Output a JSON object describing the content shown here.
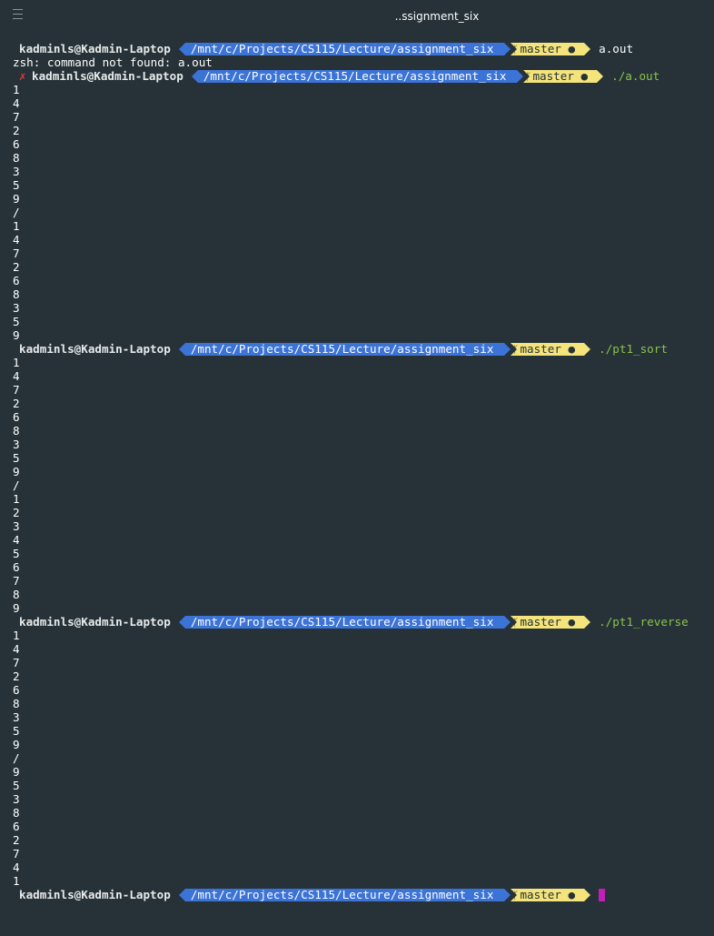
{
  "window": {
    "title": "..ssignment_six",
    "menu_icon": "hamburger-icon"
  },
  "prompt": {
    "context": "kadminls@Kadmin-Laptop",
    "dir": "/mnt/c/Projects/CS115/Lecture/assignment_six",
    "branch": "master ●",
    "error_mark": "✗"
  },
  "commands": {
    "c1": "a.out",
    "c2": "./a.out",
    "c3": "./pt1_sort",
    "c4": "./pt1_reverse"
  },
  "error_message": "zsh: command not found: a.out",
  "outputs": {
    "run_a_out": [
      "1",
      "4",
      "7",
      "2",
      "6",
      "8",
      "3",
      "5",
      "9",
      "/",
      "1",
      "4",
      "7",
      "2",
      "6",
      "8",
      "3",
      "5",
      "9"
    ],
    "run_pt1_sort": [
      "1",
      "4",
      "7",
      "2",
      "6",
      "8",
      "3",
      "5",
      "9",
      "/",
      "1",
      "2",
      "3",
      "4",
      "5",
      "6",
      "7",
      "8",
      "9"
    ],
    "run_pt1_reverse": [
      "1",
      "4",
      "7",
      "2",
      "6",
      "8",
      "3",
      "5",
      "9",
      "/",
      "9",
      "5",
      "3",
      "8",
      "6",
      "2",
      "7",
      "4",
      "1"
    ]
  },
  "colors": {
    "background": "#263238",
    "dir_segment": "#3b73d7",
    "git_segment": "#f4e47b",
    "error": "#e53935",
    "command_ok": "#8bc34a",
    "cursor": "#c020b9"
  }
}
